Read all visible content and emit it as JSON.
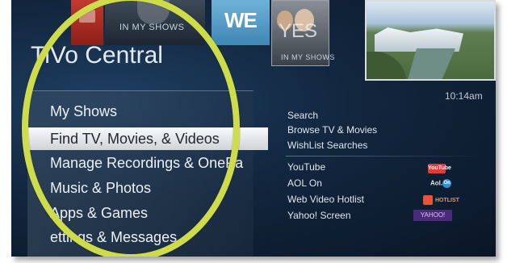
{
  "header": {
    "title": "TiVo Central",
    "tiles": [
      {
        "badge": "IN MY SHOWS"
      },
      {
        "brand": "WE"
      },
      {
        "text": "YES",
        "badge": "IN MY SHOWS"
      }
    ],
    "live_preview": "waterfall"
  },
  "clock": "10:14am",
  "main_menu": {
    "selected_index": 1,
    "items": [
      {
        "label": "My Shows"
      },
      {
        "label": "Find TV, Movies, & Videos"
      },
      {
        "label": "Manage Recordings & OnePa"
      },
      {
        "label": "Music & Photos"
      },
      {
        "label": "Apps & Games"
      },
      {
        "label": "ettings & Messages"
      }
    ]
  },
  "sub_menu": {
    "items": [
      {
        "label": "Search"
      },
      {
        "label": "Browse TV & Movies"
      },
      {
        "label": "WishList Searches"
      }
    ],
    "apps": [
      {
        "label": "YouTube",
        "logo_text": "YouTube",
        "logo_color": "#e03c31"
      },
      {
        "label": "AOL On",
        "logo_text": "Aol.",
        "badge": "On",
        "logo_color": "#2f8fd8"
      },
      {
        "label": "Web Video Hotlist",
        "logo_text": "HOTLIST",
        "logo_color": "#e8533a"
      },
      {
        "label": "Yahoo! Screen",
        "logo_text": "YAHOO!",
        "logo_color": "#4a2a7a"
      }
    ]
  },
  "highlight_color": "#cfdc4a"
}
